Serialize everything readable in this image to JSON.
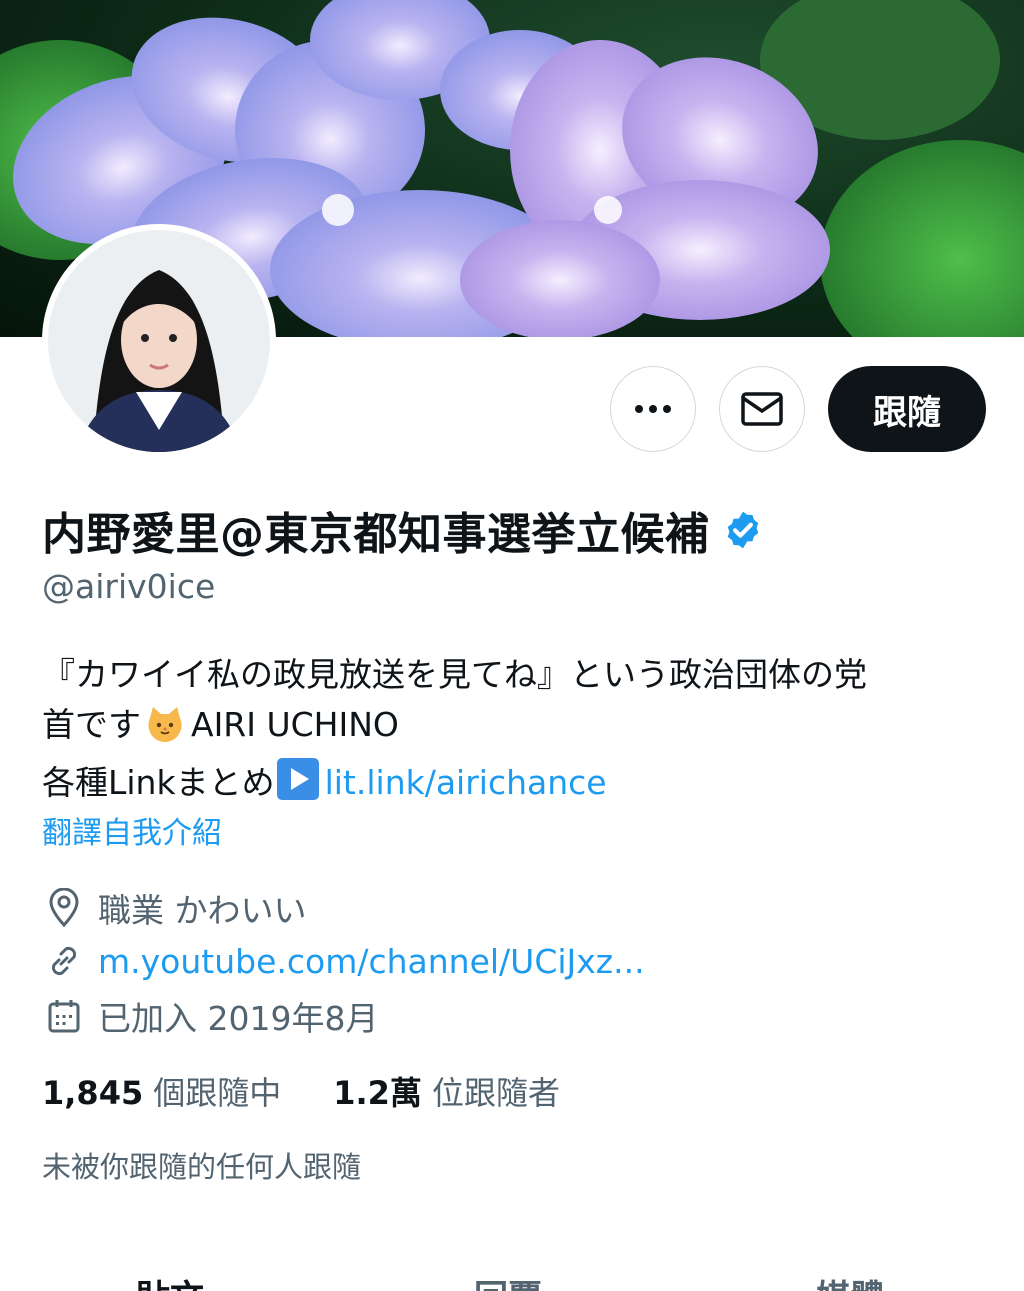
{
  "profile": {
    "display_name": "内野愛里@東京都知事選挙立候補",
    "handle": "@airiv0ice",
    "verified": true
  },
  "actions": {
    "more_icon": "more-horizontal-icon",
    "message_icon": "envelope-icon",
    "follow_label": "跟隨"
  },
  "bio": {
    "line1": "『カワイイ私の政見放送を見てね』という政治団体の党",
    "line2_text": "首です",
    "line2_emoji": "cat-face-emoji",
    "line2_suffix": "AIRI UCHINO",
    "line3_text": "各種Linkまとめ",
    "line3_emoji": "play-button-emoji",
    "line3_link": "lit.link/airichance"
  },
  "translate_label": "翻譯自我介紹",
  "meta": {
    "job": "職業 かわいい",
    "url": "m.youtube.com/channel/UCiJxz...",
    "joined": "已加入 2019年8月"
  },
  "stats": {
    "following_count": "1,845",
    "following_label": "個跟隨中",
    "followers_count": "1.2萬",
    "followers_label": "位跟隨者"
  },
  "not_followed_text": "未被你跟隨的任何人跟隨",
  "tabs": [
    {
      "label": "貼文",
      "active": true
    },
    {
      "label": "回覆",
      "active": false
    },
    {
      "label": "媒體",
      "active": false
    }
  ],
  "colors": {
    "accent": "#1d9bf0",
    "text": "#0f1419",
    "secondary": "#536471",
    "follow_button": "#0f1419"
  }
}
